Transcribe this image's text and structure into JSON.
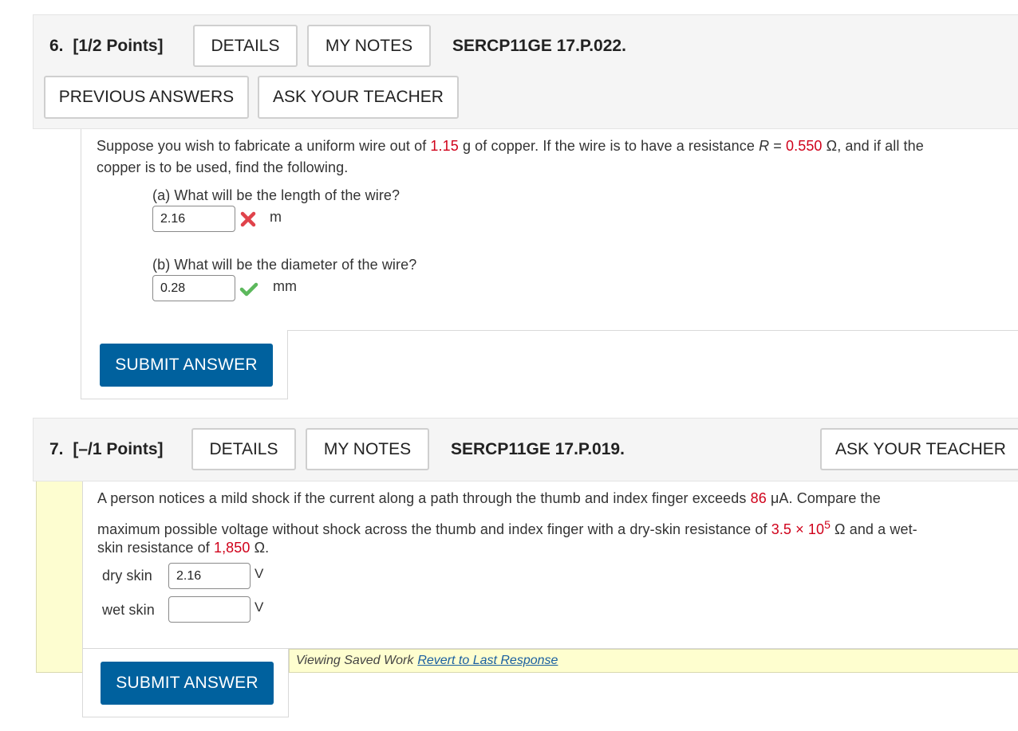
{
  "q6": {
    "number": "6.",
    "points": "[1/2 Points]",
    "details_label": "DETAILS",
    "notes_label": "MY NOTES",
    "code": "SERCP11GE 17.P.022.",
    "previous_answers_label": "PREVIOUS ANSWERS",
    "ask_teacher_label": "ASK YOUR TEACHER",
    "problem": {
      "t1": "Suppose you wish to fabricate a uniform wire out of ",
      "mass": "1.15",
      "t2": " g of copper. If the wire is to have a resistance ",
      "r_var": "R",
      "t3": " = ",
      "resistance": "0.550",
      "t4": " Ω, and if all the",
      "line2": "copper is to be used, find the following."
    },
    "part_a": {
      "question": "(a) What will be the length of the wire?",
      "value": "2.16",
      "unit": "m",
      "status": "incorrect"
    },
    "part_b": {
      "question": "(b) What will be the diameter of the wire?",
      "value": "0.28",
      "unit": "mm",
      "status": "correct"
    },
    "submit_label": "SUBMIT ANSWER"
  },
  "q7": {
    "number": "7.",
    "points": "[–/1 Points]",
    "details_label": "DETAILS",
    "notes_label": "MY NOTES",
    "code": "SERCP11GE 17.P.019.",
    "ask_teacher_label": "ASK YOUR TEACHER",
    "problem": {
      "t1": "A person notices a mild shock if the current along a path through the thumb and index finger exceeds ",
      "current": "86",
      "t2": " μA. Compare the",
      "t3": "maximum possible voltage without shock across the thumb and index finger with a dry-skin resistance of ",
      "dry_r": "3.5 × 10",
      "dry_exp": "5",
      "t4": " Ω and a wet-",
      "t5": "skin resistance of ",
      "wet_r": "1,850",
      "t6": " Ω."
    },
    "dry": {
      "label": "dry skin",
      "value": "2.16",
      "unit": "V"
    },
    "wet": {
      "label": "wet skin",
      "value": "",
      "unit": "V"
    },
    "saved_text": "Viewing Saved Work",
    "revert_label": "Revert to Last Response",
    "submit_label": "SUBMIT ANSWER"
  },
  "colors": {
    "accent": "#00619e",
    "given_value": "#d0021b",
    "correct": "#5cb85c",
    "incorrect": "#e0434b",
    "saved_bg": "#fefecf"
  },
  "icons": {
    "incorrect": "x-mark-icon",
    "correct": "check-mark-icon"
  }
}
